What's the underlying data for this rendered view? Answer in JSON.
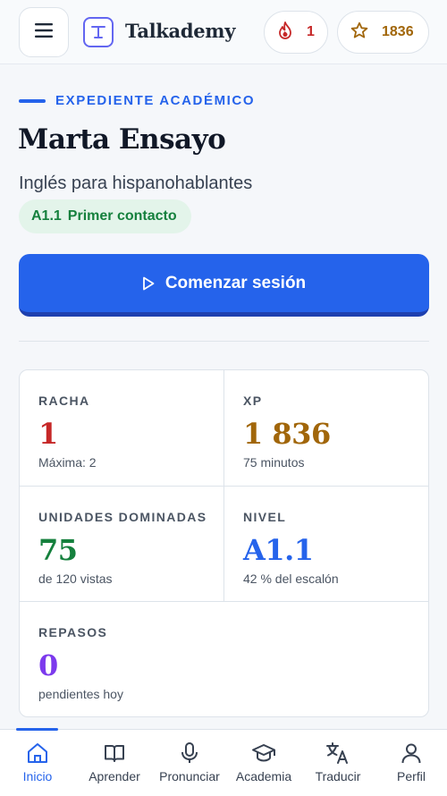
{
  "header": {
    "app_name": "Talkademy",
    "logo_letter": "T",
    "streak_count": "1",
    "xp_total": "1836",
    "icons": {
      "menu": "menu-icon",
      "streak": "flame-icon",
      "xp": "star-icon"
    }
  },
  "profile": {
    "eyebrow": "EXPEDIENTE ACADÉMICO",
    "name": "Marta Ensayo",
    "course": "Inglés para hispanohablantes",
    "level_code": "A1.1",
    "level_name": "Primer contacto"
  },
  "cta": {
    "label": "Comenzar sesión",
    "icon": "play-icon"
  },
  "stats": {
    "racha": {
      "label": "RACHA",
      "value": "1",
      "sub": "Máxima: 2"
    },
    "xp": {
      "label": "XP",
      "value": "1 836",
      "sub": "75 minutos"
    },
    "units": {
      "label": "UNIDADES DOMINADAS",
      "value": "75",
      "sub": "de 120 vistas"
    },
    "nivel": {
      "label": "NIVEL",
      "value": "A1.1",
      "sub": "42 % del escalón"
    },
    "repasos": {
      "label": "REPASOS",
      "value": "0",
      "sub": "pendientes hoy"
    }
  },
  "nav": {
    "active": "Inicio",
    "items": [
      {
        "label": "Inicio",
        "icon": "home-icon"
      },
      {
        "label": "Aprender",
        "icon": "book-icon"
      },
      {
        "label": "Pronunciar",
        "icon": "microphone-icon"
      },
      {
        "label": "Academia",
        "icon": "graduation-cap-icon"
      },
      {
        "label": "Traducir",
        "icon": "translate-icon"
      },
      {
        "label": "Perfil",
        "icon": "user-icon"
      }
    ]
  },
  "colors": {
    "accent": "#2563eb",
    "streak": "#c62828",
    "xp": "#a1660a",
    "success": "#15803d",
    "review": "#7c3aed",
    "logo": "#6366f1"
  }
}
